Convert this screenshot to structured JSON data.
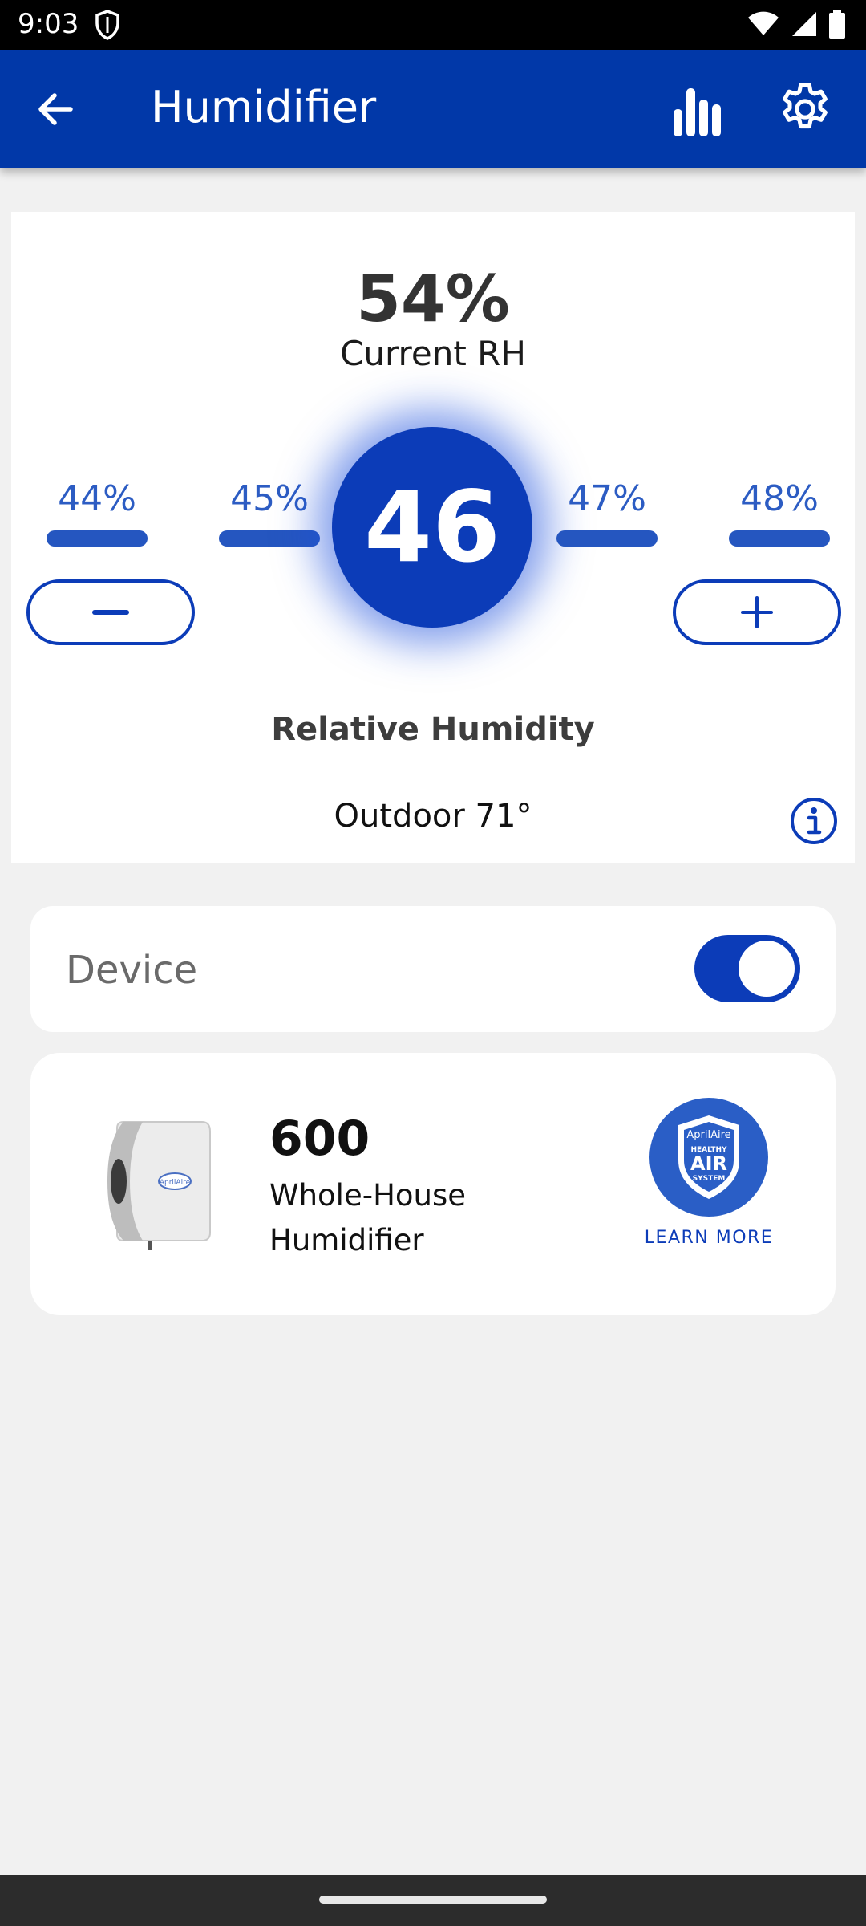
{
  "status_bar": {
    "time": "9:03",
    "icons": [
      "shield-icon",
      "wifi-icon",
      "signal-icon",
      "battery-icon"
    ]
  },
  "app_bar": {
    "title": "Humidifier",
    "icons": [
      "back-arrow-icon",
      "bar-chart-icon",
      "gear-icon"
    ]
  },
  "humidity": {
    "current_value": "54%",
    "current_label": "Current RH",
    "setpoint": "46",
    "levels": [
      "44%",
      "45%",
      "47%",
      "48%"
    ],
    "decrease_icon": "minus-icon",
    "increase_icon": "plus-icon",
    "caption": "Relative Humidity",
    "outdoor": "Outdoor 71°",
    "info_icon": "info-icon"
  },
  "device": {
    "label": "Device",
    "enabled": true
  },
  "product": {
    "model_number": "600",
    "model_name": "Whole-House Humidifier",
    "image_brand": "AprilAire",
    "badge_text": [
      "AprilAire",
      "HEALTHY",
      "AIR",
      "SYSTEM"
    ],
    "learn_more": "LEARN MORE"
  },
  "colors": {
    "primary": "#0138a8",
    "accent": "#0c3cb8",
    "level_text": "#2c5cc3",
    "background": "#f1f1f1"
  }
}
